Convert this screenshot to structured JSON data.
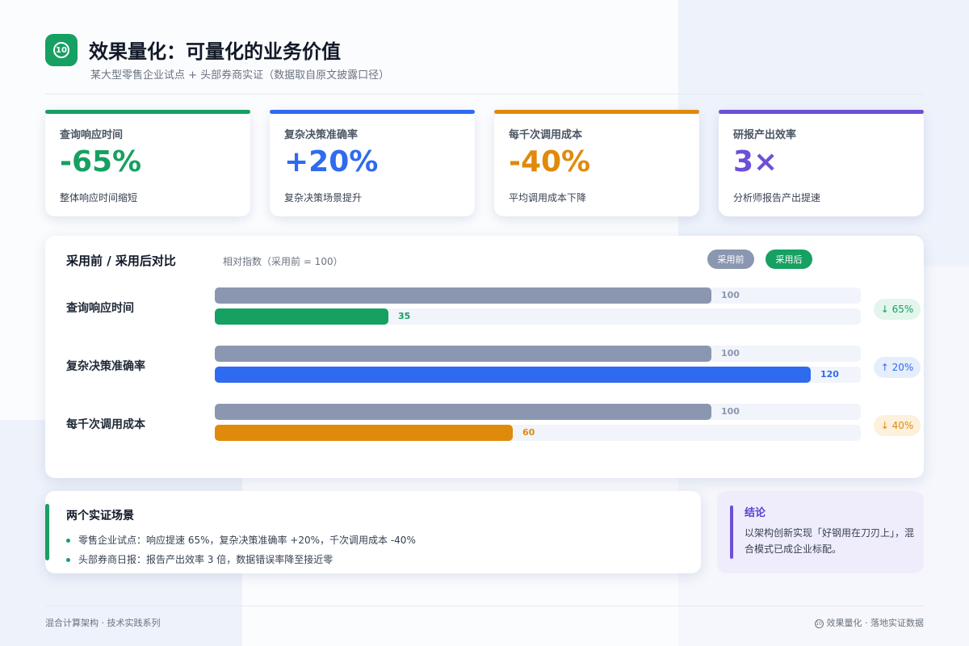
{
  "header": {
    "badge": "⑩",
    "title": "效果量化：可量化的业务价值",
    "subtitle": "某大型零售企业试点 + 头部券商实证（数据取自原文披露口径）"
  },
  "kpis": [
    {
      "label": "查询响应时间",
      "value": "-65%",
      "desc": "整体响应时间缩短",
      "color": "#16a062"
    },
    {
      "label": "复杂决策准确率",
      "value": "+20%",
      "desc": "复杂决策场景提升",
      "color": "#2f6bf0"
    },
    {
      "label": "每千次调用成本",
      "value": "-40%",
      "desc": "平均调用成本下降",
      "color": "#e08a0b"
    },
    {
      "label": "研报产出效率",
      "value": "3×",
      "desc": "分析师报告产出提速",
      "color": "#6d4fd8"
    }
  ],
  "comparison": {
    "title": "采用前 / 采用后对比",
    "note": "相对指数（采用前 = 100）",
    "legend_before": "采用前",
    "legend_after": "采用后",
    "before_color": "#8b97b0",
    "scale_max": 130,
    "rows": [
      {
        "label": "查询响应时间",
        "before": 100,
        "after": 35,
        "after_color": "#16a062",
        "delta": "↓ 65%",
        "delta_bg": "#e3f5ec",
        "delta_color": "#16a062"
      },
      {
        "label": "复杂决策准确率",
        "before": 100,
        "after": 120,
        "after_color": "#2f6bf0",
        "delta": "↑ 20%",
        "delta_bg": "#e6eefc",
        "delta_color": "#2f6bf0"
      },
      {
        "label": "每千次调用成本",
        "before": 100,
        "after": 60,
        "after_color": "#e08a0b",
        "delta": "↓ 40%",
        "delta_bg": "#fdf0dc",
        "delta_color": "#e08a0b"
      }
    ]
  },
  "scenes": {
    "title": "两个实证场景",
    "items": [
      "零售企业试点：响应提速 65%，复杂决策准确率 +20%，千次调用成本 -40%",
      "头部券商日报：报告产出效率 3 倍，数据错误率降至接近零"
    ]
  },
  "conclusion": {
    "title": "结论",
    "text": "以架构创新实现「好钢用在刀刃上」，混合模式已成企业标配。"
  },
  "footer": {
    "left": "混合计算架构 · 技术实践系列",
    "badge": "10",
    "right": "效果量化 · 落地实证数据"
  }
}
